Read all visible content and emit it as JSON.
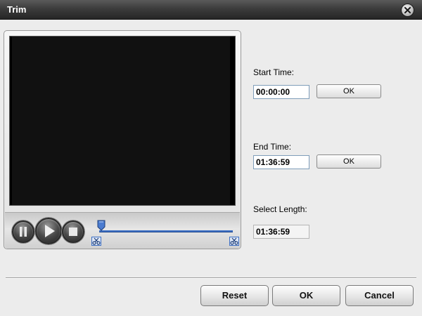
{
  "window": {
    "title": "Trim"
  },
  "icons": {
    "close": "close-icon",
    "pause": "pause-icon",
    "play": "play-icon",
    "stop": "stop-icon",
    "scissors": "scissors-icon",
    "handle": "playhead-handle-icon"
  },
  "colors": {
    "titlebar": "#2e2e2e",
    "track": "#3d6fc4",
    "video": "#000000"
  },
  "trim": {
    "start_label": "Start Time:",
    "start_value": "00:00:00",
    "start_ok": "OK",
    "end_label": "End Time:",
    "end_value": "01:36:59",
    "end_ok": "OK",
    "length_label": "Select Length:",
    "length_value": "01:36:59"
  },
  "footer": {
    "reset_label": "Reset",
    "ok_label": "OK",
    "cancel_label": "Cancel"
  }
}
